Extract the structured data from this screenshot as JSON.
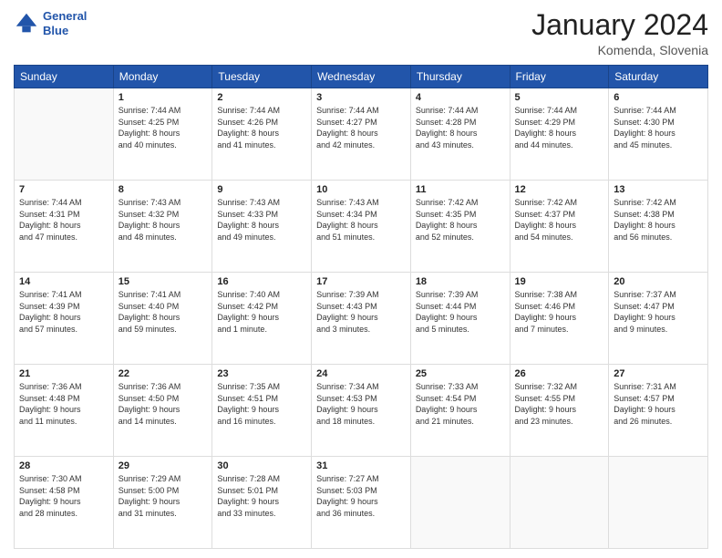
{
  "header": {
    "logo_line1": "General",
    "logo_line2": "Blue",
    "title": "January 2024",
    "location": "Komenda, Slovenia"
  },
  "weekdays": [
    "Sunday",
    "Monday",
    "Tuesday",
    "Wednesday",
    "Thursday",
    "Friday",
    "Saturday"
  ],
  "weeks": [
    [
      {
        "day": "",
        "info": ""
      },
      {
        "day": "1",
        "info": "Sunrise: 7:44 AM\nSunset: 4:25 PM\nDaylight: 8 hours\nand 40 minutes."
      },
      {
        "day": "2",
        "info": "Sunrise: 7:44 AM\nSunset: 4:26 PM\nDaylight: 8 hours\nand 41 minutes."
      },
      {
        "day": "3",
        "info": "Sunrise: 7:44 AM\nSunset: 4:27 PM\nDaylight: 8 hours\nand 42 minutes."
      },
      {
        "day": "4",
        "info": "Sunrise: 7:44 AM\nSunset: 4:28 PM\nDaylight: 8 hours\nand 43 minutes."
      },
      {
        "day": "5",
        "info": "Sunrise: 7:44 AM\nSunset: 4:29 PM\nDaylight: 8 hours\nand 44 minutes."
      },
      {
        "day": "6",
        "info": "Sunrise: 7:44 AM\nSunset: 4:30 PM\nDaylight: 8 hours\nand 45 minutes."
      }
    ],
    [
      {
        "day": "7",
        "info": "Sunrise: 7:44 AM\nSunset: 4:31 PM\nDaylight: 8 hours\nand 47 minutes."
      },
      {
        "day": "8",
        "info": "Sunrise: 7:43 AM\nSunset: 4:32 PM\nDaylight: 8 hours\nand 48 minutes."
      },
      {
        "day": "9",
        "info": "Sunrise: 7:43 AM\nSunset: 4:33 PM\nDaylight: 8 hours\nand 49 minutes."
      },
      {
        "day": "10",
        "info": "Sunrise: 7:43 AM\nSunset: 4:34 PM\nDaylight: 8 hours\nand 51 minutes."
      },
      {
        "day": "11",
        "info": "Sunrise: 7:42 AM\nSunset: 4:35 PM\nDaylight: 8 hours\nand 52 minutes."
      },
      {
        "day": "12",
        "info": "Sunrise: 7:42 AM\nSunset: 4:37 PM\nDaylight: 8 hours\nand 54 minutes."
      },
      {
        "day": "13",
        "info": "Sunrise: 7:42 AM\nSunset: 4:38 PM\nDaylight: 8 hours\nand 56 minutes."
      }
    ],
    [
      {
        "day": "14",
        "info": "Sunrise: 7:41 AM\nSunset: 4:39 PM\nDaylight: 8 hours\nand 57 minutes."
      },
      {
        "day": "15",
        "info": "Sunrise: 7:41 AM\nSunset: 4:40 PM\nDaylight: 8 hours\nand 59 minutes."
      },
      {
        "day": "16",
        "info": "Sunrise: 7:40 AM\nSunset: 4:42 PM\nDaylight: 9 hours\nand 1 minute."
      },
      {
        "day": "17",
        "info": "Sunrise: 7:39 AM\nSunset: 4:43 PM\nDaylight: 9 hours\nand 3 minutes."
      },
      {
        "day": "18",
        "info": "Sunrise: 7:39 AM\nSunset: 4:44 PM\nDaylight: 9 hours\nand 5 minutes."
      },
      {
        "day": "19",
        "info": "Sunrise: 7:38 AM\nSunset: 4:46 PM\nDaylight: 9 hours\nand 7 minutes."
      },
      {
        "day": "20",
        "info": "Sunrise: 7:37 AM\nSunset: 4:47 PM\nDaylight: 9 hours\nand 9 minutes."
      }
    ],
    [
      {
        "day": "21",
        "info": "Sunrise: 7:36 AM\nSunset: 4:48 PM\nDaylight: 9 hours\nand 11 minutes."
      },
      {
        "day": "22",
        "info": "Sunrise: 7:36 AM\nSunset: 4:50 PM\nDaylight: 9 hours\nand 14 minutes."
      },
      {
        "day": "23",
        "info": "Sunrise: 7:35 AM\nSunset: 4:51 PM\nDaylight: 9 hours\nand 16 minutes."
      },
      {
        "day": "24",
        "info": "Sunrise: 7:34 AM\nSunset: 4:53 PM\nDaylight: 9 hours\nand 18 minutes."
      },
      {
        "day": "25",
        "info": "Sunrise: 7:33 AM\nSunset: 4:54 PM\nDaylight: 9 hours\nand 21 minutes."
      },
      {
        "day": "26",
        "info": "Sunrise: 7:32 AM\nSunset: 4:55 PM\nDaylight: 9 hours\nand 23 minutes."
      },
      {
        "day": "27",
        "info": "Sunrise: 7:31 AM\nSunset: 4:57 PM\nDaylight: 9 hours\nand 26 minutes."
      }
    ],
    [
      {
        "day": "28",
        "info": "Sunrise: 7:30 AM\nSunset: 4:58 PM\nDaylight: 9 hours\nand 28 minutes."
      },
      {
        "day": "29",
        "info": "Sunrise: 7:29 AM\nSunset: 5:00 PM\nDaylight: 9 hours\nand 31 minutes."
      },
      {
        "day": "30",
        "info": "Sunrise: 7:28 AM\nSunset: 5:01 PM\nDaylight: 9 hours\nand 33 minutes."
      },
      {
        "day": "31",
        "info": "Sunrise: 7:27 AM\nSunset: 5:03 PM\nDaylight: 9 hours\nand 36 minutes."
      },
      {
        "day": "",
        "info": ""
      },
      {
        "day": "",
        "info": ""
      },
      {
        "day": "",
        "info": ""
      }
    ]
  ]
}
